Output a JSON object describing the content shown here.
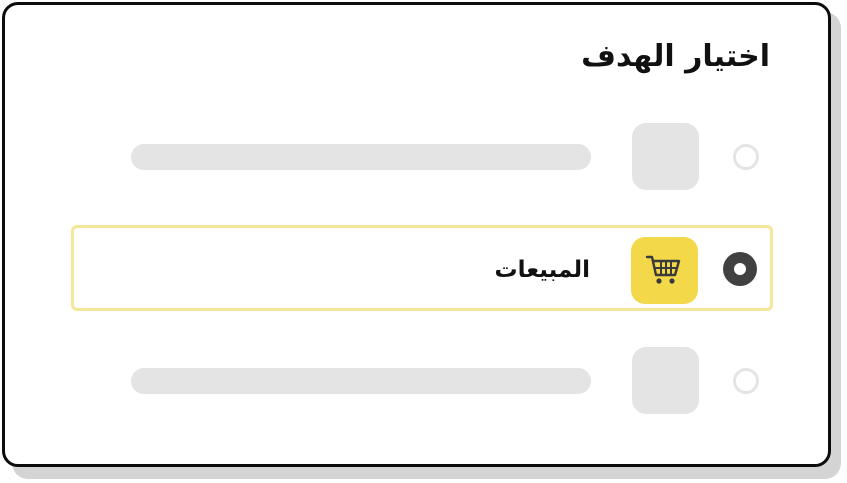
{
  "panel": {
    "title": "اختيار الهدف"
  },
  "options": [
    {
      "state": "placeholder",
      "selected": false
    },
    {
      "state": "filled",
      "selected": true,
      "label": "المبيعات",
      "icon": "shopping-cart-icon"
    },
    {
      "state": "placeholder",
      "selected": false
    }
  ],
  "colors": {
    "accent": "#f3d94a",
    "selected_border": "#f6e697",
    "radio_checked": "#414141",
    "placeholder": "#e4e4e4",
    "card_border": "#0c0c0c",
    "shadow": "#d4d4d4"
  }
}
